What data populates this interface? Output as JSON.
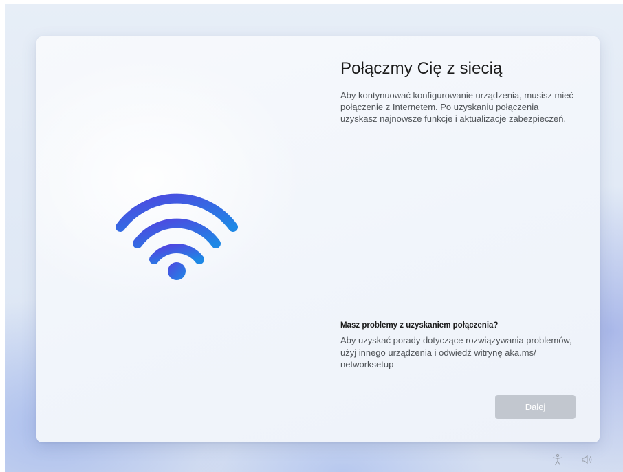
{
  "setup": {
    "title": "Połączmy Cię z siecią",
    "description": "Aby kontynuować konfigurowanie urządzenia, musisz mieć połączenie z Internetem. Po uzyskaniu połączenia uzyskasz najnowsze funkcje i aktualizacje zabezpieczeń.",
    "illustration_icon": "wifi-icon",
    "help": {
      "heading": "Masz problemy z uzyskaniem połączenia?",
      "text": "Aby uzyskać porady dotyczące rozwiązywania problemów, użyj innego urządzenia i odwiedź witrynę aka.ms/ networksetup"
    },
    "next_button": "Dalej"
  },
  "tray": {
    "icons": [
      "accessibility-icon",
      "volume-icon"
    ]
  },
  "colors": {
    "wifi_gradient_start": "#4f46e5",
    "wifi_gradient_end": "#1e8be6",
    "button_disabled_bg": "#c2c7cf"
  }
}
